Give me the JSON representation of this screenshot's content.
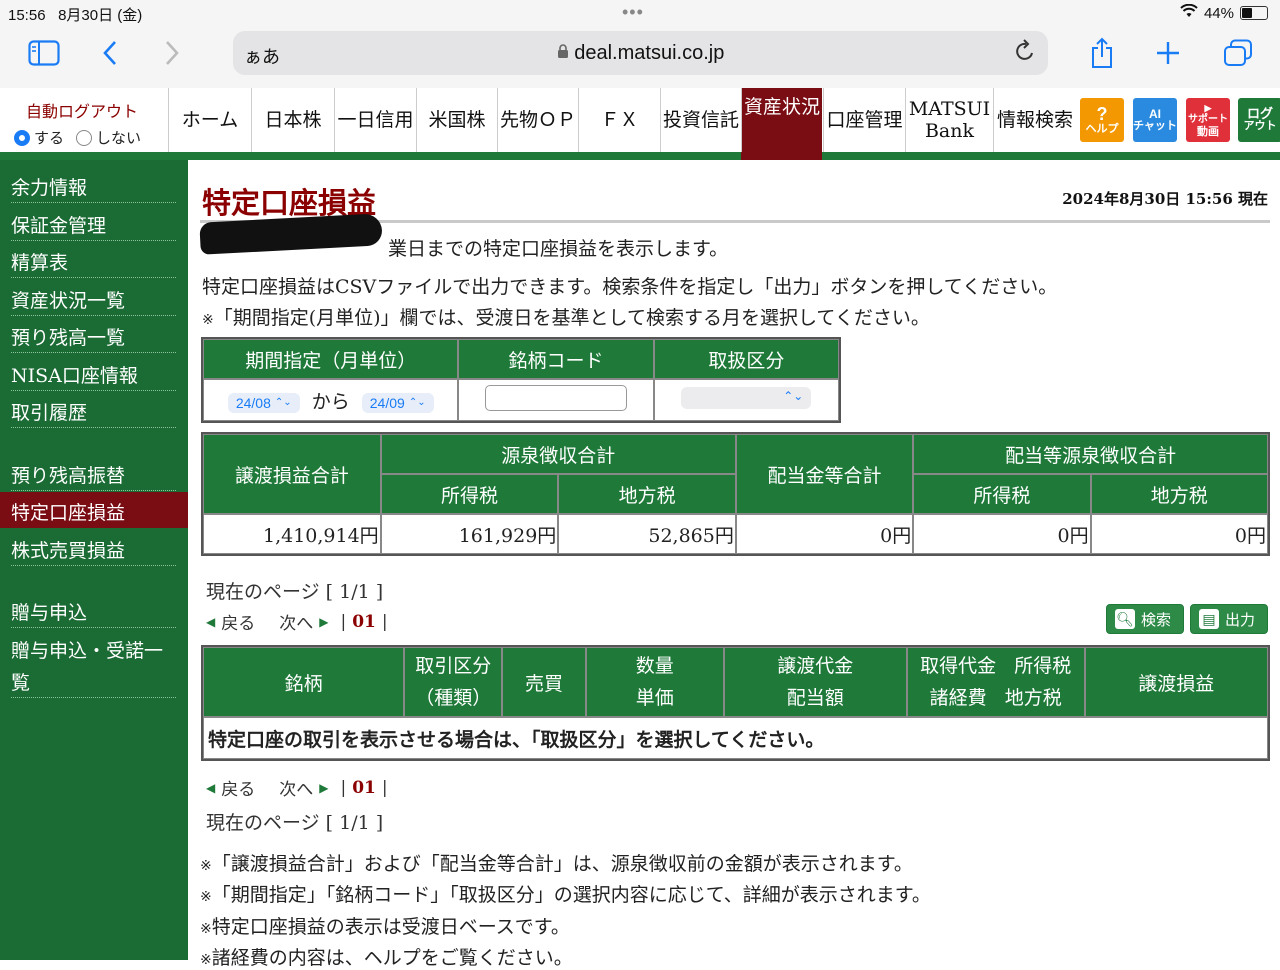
{
  "status_bar": {
    "time": "15:56",
    "date": "8月30日 (金)",
    "battery": "44%",
    "battery_level": 0.44
  },
  "browser": {
    "aa": "ぁあ",
    "url": "deal.matsui.co.jp"
  },
  "auto_logout": {
    "title": "自動ログアウト",
    "on": "する",
    "off": "しない"
  },
  "nav": [
    {
      "label": "ホーム"
    },
    {
      "label": "日本株"
    },
    {
      "label": "一日信用"
    },
    {
      "label": "米国株"
    },
    {
      "label": "先物ＯＰ"
    },
    {
      "label": "ＦＸ"
    },
    {
      "label": "投資信託"
    },
    {
      "label": "資産状況"
    },
    {
      "label": "口座管理"
    },
    {
      "label": "MATSUI",
      "label2": "Bank"
    },
    {
      "label": "情報検索"
    }
  ],
  "icon_buttons": [
    {
      "label": "ヘルプ",
      "glyph": "?",
      "color": "#f39800"
    },
    {
      "label": "チャット",
      "glyph": "AI",
      "color": "#2a8ae0"
    },
    {
      "label": "動画",
      "glyph": "サポート",
      "color": "#e0303a"
    },
    {
      "label": "アウト",
      "glyph": "ログ",
      "color": "#1f7a3a"
    }
  ],
  "sidebar": [
    {
      "label": "余力情報"
    },
    {
      "label": "保証金管理"
    },
    {
      "label": "精算表"
    },
    {
      "label": "資産状況一覧"
    },
    {
      "label": "預り残高一覧"
    },
    {
      "label": "NISA口座情報"
    },
    {
      "label": "取引履歴"
    },
    {
      "label": "預り残高振替"
    },
    {
      "label": "特定口座損益"
    },
    {
      "label": "株式売買損益"
    },
    {
      "label": "贈与申込"
    },
    {
      "label": "贈与申込・受諾一",
      "label2": "覧"
    }
  ],
  "main": {
    "title": "特定口座損益",
    "datestamp": "2024年8月30日 15:56 現在",
    "intro1": "業日までの特定口座損益を表示します。",
    "intro2": "特定口座損益はCSVファイルで出力できます。検索条件を指定し「出力」ボタンを押してください。",
    "intro3": "「期間指定(月単位)」欄では、受渡日を基準として検索する月を選択してください。",
    "search": {
      "period_label": "期間指定（月単位）",
      "code_label": "銘柄コード",
      "class_label": "取扱区分",
      "from_value": "24/08",
      "kara": "から",
      "to_value": "24/09"
    },
    "summary": {
      "h_transfer": "譲渡損益合計",
      "h_withholding": "源泉徴収合計",
      "h_income_tax": "所得税",
      "h_local_tax": "地方税",
      "h_dividend": "配当金等合計",
      "h_div_withholding": "配当等源泉徴収合計",
      "v_transfer": "1,410,914円",
      "v_income_tax": "161,929円",
      "v_local_tax": "52,865円",
      "v_dividend": "0円",
      "v_div_income_tax": "0円",
      "v_div_local_tax": "0円"
    },
    "pager": {
      "current_page": "現在のページ [ 1/1 ]",
      "back": "戻る",
      "next": "次へ",
      "page": "01"
    },
    "buttons": {
      "search": "検索",
      "output": "出力"
    },
    "results": {
      "h_meigara": "銘柄",
      "h_torihiki": "取引区分",
      "h_shurui": "（種類）",
      "h_baibai": "売買",
      "h_suryo": "数量",
      "h_tanka": "単価",
      "h_joto_daikin": "譲渡代金",
      "h_haito": "配当額",
      "h_shutoku": "取得代金",
      "h_shokeihi": "諸経費",
      "h_shotoku": "所得税",
      "h_chiho": "地方税",
      "h_joto_soneki": "譲渡損益",
      "message": "特定口座の取引を表示させる場合は、「取扱区分」を選択してください。"
    },
    "notes": [
      "「譲渡損益合計」および「配当金等合計」は、源泉徴収前の金額が表示されます。",
      "「期間指定」「銘柄コード」「取扱区分」の選択内容に応じて、詳細が表示されます。",
      "特定口座損益の表示は受渡日ベースです。",
      "諸経費の内容は、ヘルプをご覧ください。"
    ]
  }
}
